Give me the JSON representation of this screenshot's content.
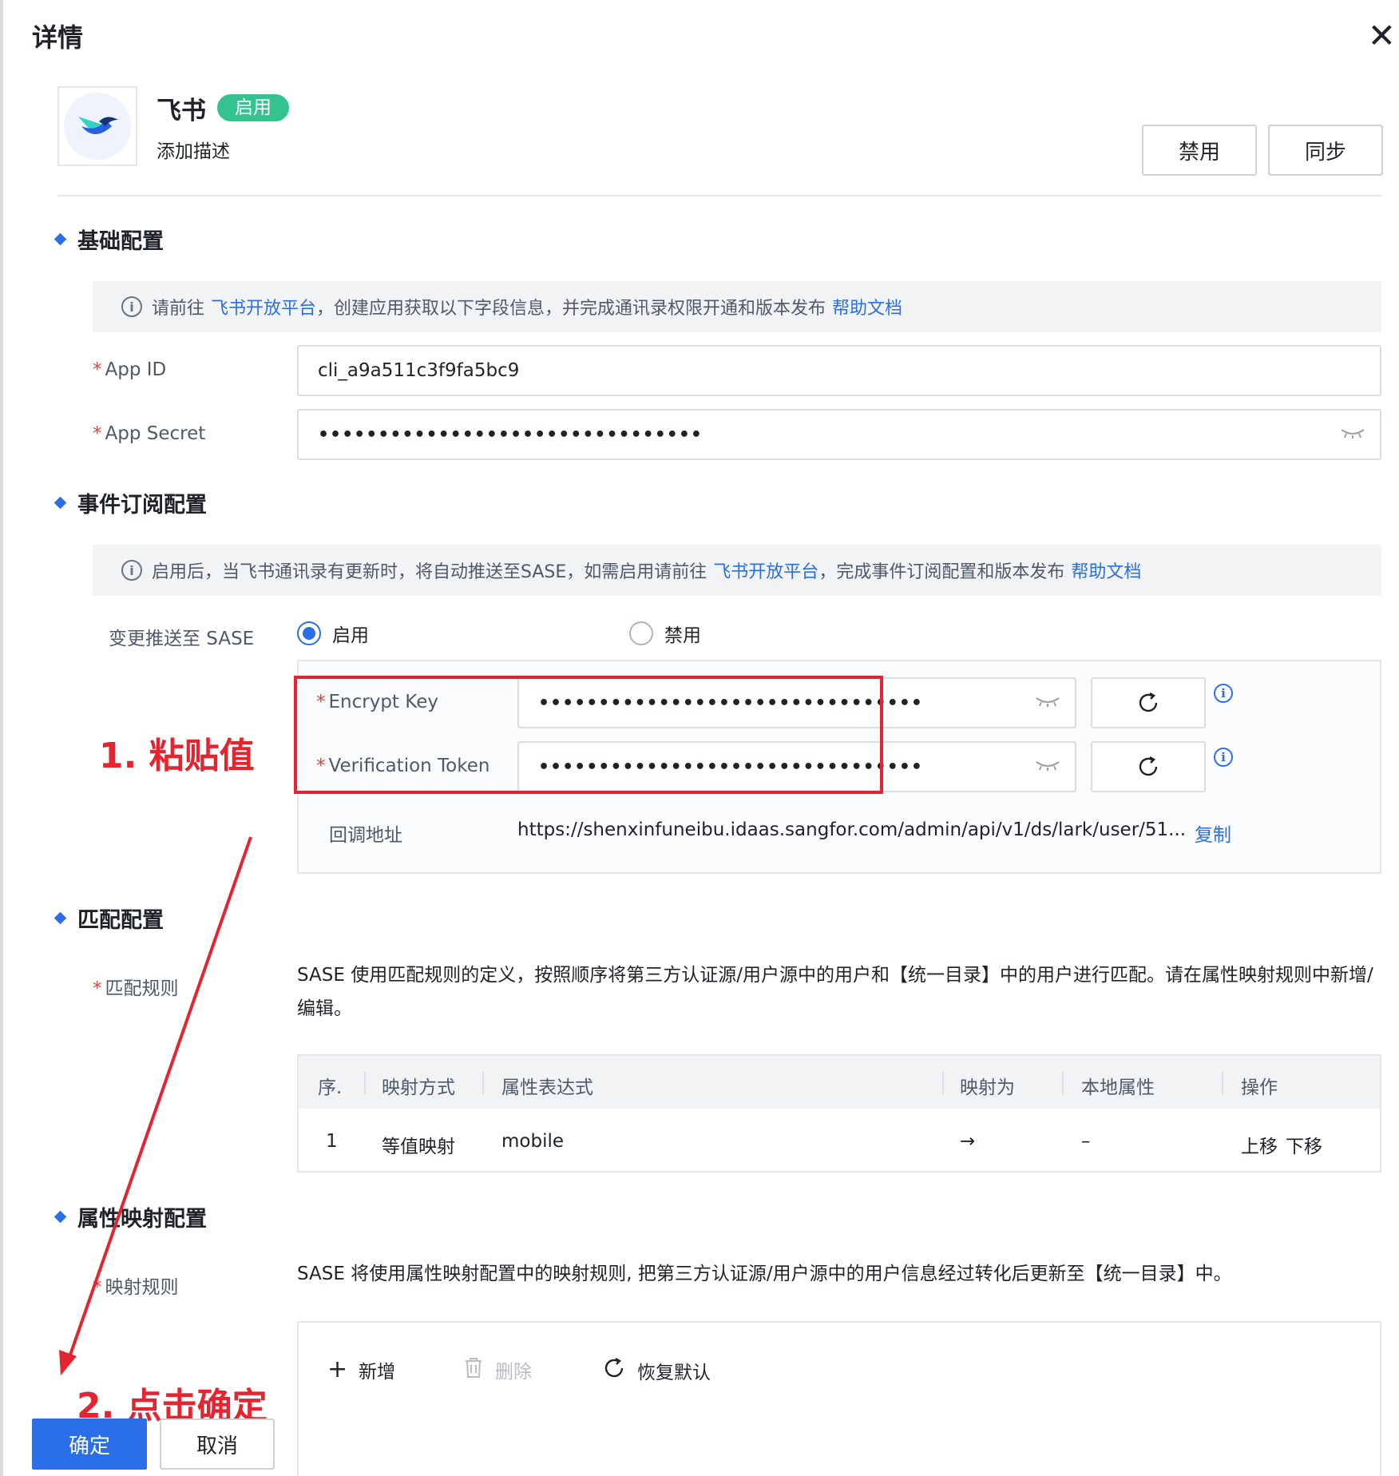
{
  "dialog": {
    "title": "详情",
    "close": "✕"
  },
  "app": {
    "name": "飞书",
    "status": "启用",
    "description": "添加描述",
    "disable_btn": "禁用",
    "sync_btn": "同步"
  },
  "basic": {
    "title": "基础配置",
    "tip": {
      "pre": "请前往",
      "link1": "飞书开放平台",
      "mid": "，创建应用获取以下字段信息，并完成通讯录权限开通和版本发布",
      "link2": "帮助文档"
    },
    "app_id_label": "App ID",
    "app_id_value": "cli_a9a511c3f9fa5bc9",
    "app_secret_label": "App Secret",
    "app_secret_value": "••••••••••••••••••••••••••••••••"
  },
  "event": {
    "title": "事件订阅配置",
    "tip": {
      "pre": "启用后，当飞书通讯录有更新时，将自动推送至SASE，如需启用请前往",
      "link1": "飞书开放平台",
      "mid": "，完成事件订阅配置和版本发布",
      "link2": "帮助文档"
    },
    "push_label": "变更推送至 SASE",
    "opt_enable": "启用",
    "opt_disable": "禁用",
    "encrypt_label": "Encrypt Key",
    "encrypt_value": "••••••••••••••••••••••••••••••••",
    "token_label": "Verification Token",
    "token_value": "••••••••••••••••••••••••••••••••",
    "callback_label": "回调地址",
    "callback_value": "https://shenxinfuneibu.idaas.sangfor.com/admin/api/v1/ds/lark/user/51...",
    "copy": "复制"
  },
  "annotations": {
    "step1": "1. 粘贴值",
    "step2": "2. 点击确定"
  },
  "match": {
    "title": "匹配配置",
    "rule_label": "匹配规则",
    "desc": "SASE 使用匹配规则的定义，按照顺序将第三方认证源/用户源中的用户和【统一目录】中的用户进行匹配。请在属性映射规则中新增/编辑。",
    "columns": [
      "序.",
      "映射方式",
      "属性表达式",
      "映射为",
      "本地属性",
      "操作"
    ],
    "rows": [
      {
        "idx": "1",
        "method": "等值映射",
        "expr": "mobile",
        "to": "→",
        "local": "–",
        "up": "上移",
        "down": "下移"
      }
    ]
  },
  "attr": {
    "title": "属性映射配置",
    "rule_label": "映射规则",
    "desc": "SASE 将使用属性映射配置中的映射规则, 把第三方认证源/用户源中的用户信息经过转化后更新至【统一目录】中。",
    "add": "新增",
    "delete": "删除",
    "reset": "恢复默认"
  },
  "footer": {
    "confirm": "确定",
    "cancel": "取消"
  }
}
